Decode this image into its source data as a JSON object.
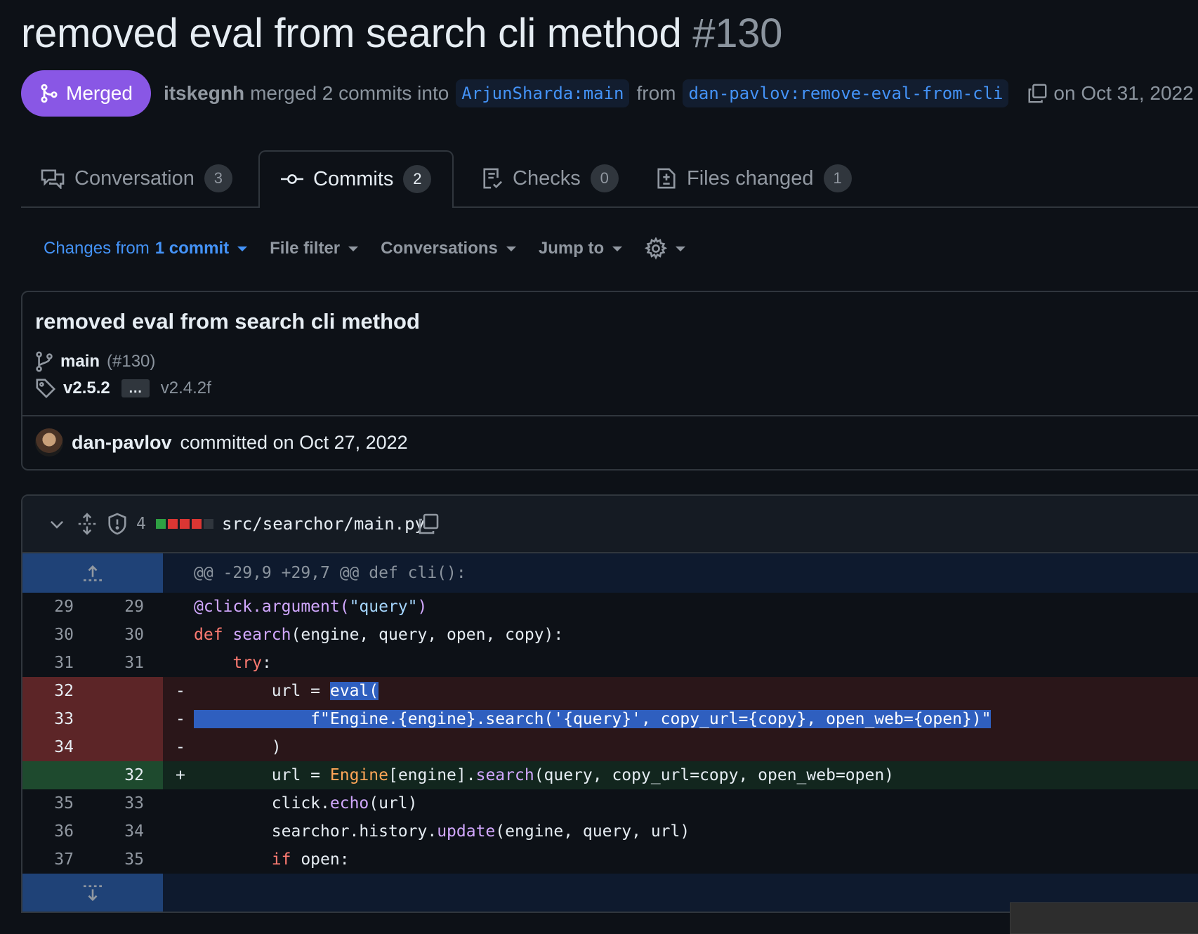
{
  "pr": {
    "title": "removed eval from search cli method",
    "number": "#130",
    "status": "Merged",
    "author": "itskegnh",
    "merged_text": "merged 2 commits into",
    "base_branch": "ArjunSharda:main",
    "from_text": "from",
    "head_branch": "dan-pavlov:remove-eval-from-cli",
    "date_text": "on Oct 31, 2022",
    "status_color": "#8957e5"
  },
  "tabs": [
    {
      "label": "Conversation",
      "count": "3",
      "icon": "comment-discussion-icon"
    },
    {
      "label": "Commits",
      "count": "2",
      "icon": "git-commit-icon"
    },
    {
      "label": "Checks",
      "count": "0",
      "icon": "checklist-icon"
    },
    {
      "label": "Files changed",
      "count": "1",
      "icon": "file-diff-icon"
    }
  ],
  "toolbar": {
    "changes_prefix": "Changes from",
    "changes_bold": "1 commit",
    "file_filter": "File filter",
    "conversations": "Conversations",
    "jump_to": "Jump to"
  },
  "commit": {
    "title": "removed eval from search cli method",
    "branch": "main",
    "pr_ref": "(#130)",
    "tag_first": "v2.5.2",
    "tag_ellipsis": "…",
    "tag_last": "v2.4.2f",
    "committer": "dan-pavlov",
    "committed_text": "committed on Oct 27, 2022"
  },
  "file": {
    "changes": "4",
    "path": "src/searchor/main.py",
    "diffstat": [
      "add",
      "del",
      "del",
      "del",
      "neutral"
    ],
    "hunk_header": "@@ -29,9 +29,7 @@ def cli():",
    "lines": {
      "l1": {
        "old": "29",
        "new": "29",
        "sign": "",
        "t1": "@click.argument(",
        "t2": "\"query\"",
        "t3": ")"
      },
      "l2": {
        "old": "30",
        "new": "30",
        "sign": "",
        "t1": "def",
        "t2": "search",
        "t3": "(engine, query, open, copy):"
      },
      "l3": {
        "old": "31",
        "new": "31",
        "sign": "",
        "t1": "    ",
        "t2": "try",
        "t3": ":"
      },
      "l4": {
        "old": "32",
        "new": "",
        "sign": "-",
        "t1": "        url = ",
        "t2": "eval("
      },
      "l5": {
        "old": "33",
        "new": "",
        "sign": "-",
        "t1": "            ",
        "t2": "f\"Engine.{engine}.search('{query}', copy_url={copy}, open_web={open})\""
      },
      "l6": {
        "old": "34",
        "new": "",
        "sign": "-",
        "t1": "        )"
      },
      "l7": {
        "old": "",
        "new": "32",
        "sign": "+",
        "t1": "        url = ",
        "t2": "Engine",
        "t3": "[engine].",
        "t4": "search",
        "t5": "(query, copy_url=copy, open_web=open)"
      },
      "l8": {
        "old": "35",
        "new": "33",
        "sign": "",
        "t1": "        click.",
        "t2": "echo",
        "t3": "(url)"
      },
      "l9": {
        "old": "36",
        "new": "34",
        "sign": "",
        "t1": "        searchor.history.",
        "t2": "update",
        "t3": "(engine, query, url)"
      },
      "l10": {
        "old": "37",
        "new": "35",
        "sign": "",
        "t1": "        ",
        "t2": "if",
        "t3": " open:"
      }
    }
  }
}
